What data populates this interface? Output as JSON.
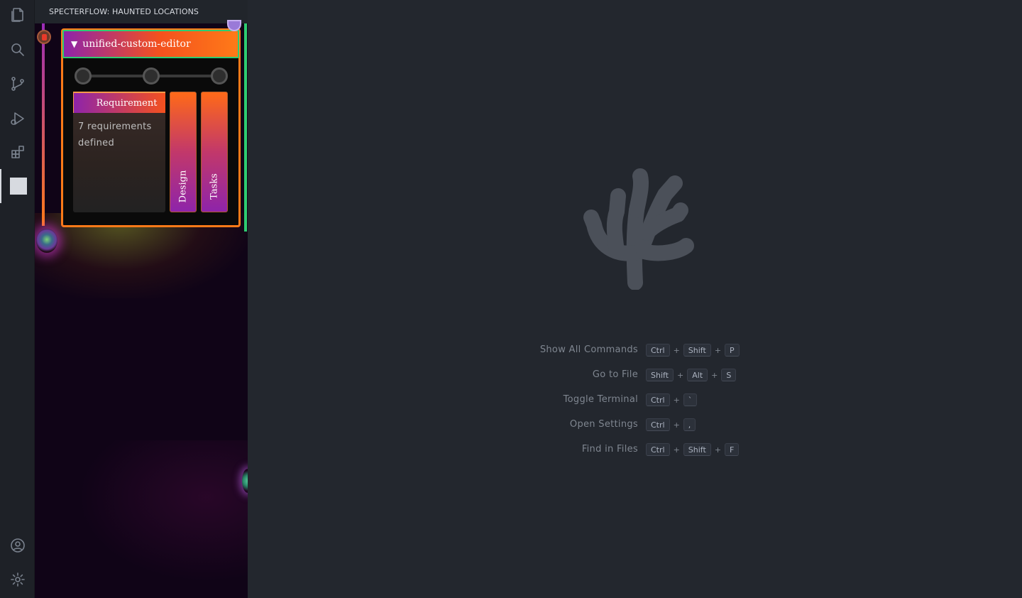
{
  "activity_bar": {
    "icons": [
      "files-icon",
      "search-icon",
      "source-control-icon",
      "run-debug-icon",
      "extensions-icon",
      "specterflow-icon"
    ],
    "bottom_icons": [
      "account-icon",
      "settings-gear-icon"
    ]
  },
  "sidebar": {
    "title": "SPECTERFLOW: HAUNTED LOCATIONS",
    "editor": {
      "title": "unified-custom-editor",
      "expand_indicator": "▼",
      "steps": 3,
      "requirement_tab": "Requirement",
      "requirement_text": "7 requirements defined",
      "design_tab": "Design",
      "tasks_tab": "Tasks"
    }
  },
  "main": {
    "shortcuts": [
      {
        "label": "Show All Commands",
        "keys": [
          "Ctrl",
          "Shift",
          "P"
        ]
      },
      {
        "label": "Go to File",
        "keys": [
          "Shift",
          "Alt",
          "S"
        ]
      },
      {
        "label": "Toggle Terminal",
        "keys": [
          "Ctrl",
          "`"
        ]
      },
      {
        "label": "Open Settings",
        "keys": [
          "Ctrl",
          ","
        ]
      },
      {
        "label": "Find in Files",
        "keys": [
          "Ctrl",
          "Shift",
          "F"
        ]
      }
    ],
    "plus_sign": "+"
  },
  "colors": {
    "accent_orange": "#ff7a18",
    "accent_purple": "#8e24aa",
    "accent_green": "#2ecc71",
    "background": "#23272e"
  }
}
